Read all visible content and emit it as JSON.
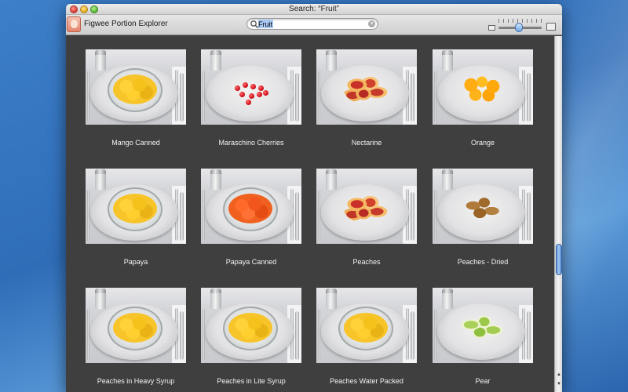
{
  "window": {
    "title": "Search: “Fruit”"
  },
  "toolbar": {
    "app_name": "Figwee Portion Explorer",
    "search": {
      "value": "Fruit",
      "placeholder": ""
    },
    "zoom_level": 0.45
  },
  "foods": [
    {
      "name": "Mango Canned",
      "style": "food-cubes",
      "bowl": true
    },
    {
      "name": "Maraschino Cherries",
      "style": "food-dots",
      "bowl": false
    },
    {
      "name": "Nectarine",
      "style": "food-slices",
      "bowl": false
    },
    {
      "name": "Orange",
      "style": "food-orange",
      "bowl": false
    },
    {
      "name": "Papaya",
      "style": "food-cubes",
      "bowl": true
    },
    {
      "name": "Papaya Canned",
      "style": "food-red-cubes",
      "bowl": true
    },
    {
      "name": "Peaches",
      "style": "food-slices",
      "bowl": false
    },
    {
      "name": "Peaches - Dried",
      "style": "food-dried",
      "bowl": false
    },
    {
      "name": "Peaches in Heavy Syrup",
      "style": "food-cubes",
      "bowl": true
    },
    {
      "name": "Peaches in Lite Syrup",
      "style": "food-cubes",
      "bowl": true
    },
    {
      "name": "Peaches Water Packed",
      "style": "food-cubes",
      "bowl": true
    },
    {
      "name": "Pear",
      "style": "food-pear",
      "bowl": false
    }
  ],
  "colors": {
    "content_background": "#3f3f3f",
    "caption_text": "#f2f2f2",
    "scroll_accent": "#5d8fd6"
  },
  "icons": {
    "close": "close-button",
    "minimize": "minimize-button",
    "zoom": "zoom-button",
    "search": "search-icon",
    "clear": "clear-icon",
    "small_thumbnails": "small-thumbnail-icon",
    "large_thumbnails": "large-thumbnail-icon"
  }
}
